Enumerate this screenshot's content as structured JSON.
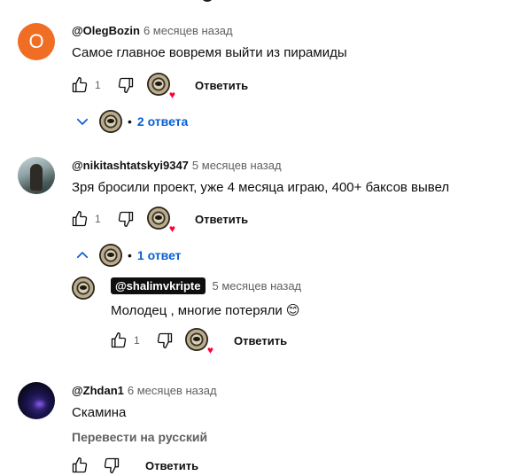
{
  "comments": [
    {
      "author": "@OlegBozin",
      "time": "6 месяцев назад",
      "avatar_letter": "O",
      "text": "Самое главное вовремя выйти из пирамиды",
      "likes": "1",
      "reply_label": "Ответить",
      "replies_label": "2 ответа"
    },
    {
      "author": "@nikitashtatskyi9347",
      "time": "5 месяцев назад",
      "text": "Зря бросили проект, уже 4 месяца играю, 400+ баксов вывел",
      "likes": "1",
      "reply_label": "Ответить",
      "replies_label": "1 ответ",
      "reply": {
        "author": "@shalimvkripte",
        "time": "5 месяцев назад",
        "text": "Молодец , многие потеряли 😊",
        "likes": "1",
        "reply_label": "Ответить"
      }
    },
    {
      "author": "@Zhdan1",
      "time": "6 месяцев назад",
      "text": "Скамина",
      "translate_label": "Перевести на русский",
      "reply_label": "Ответить"
    }
  ],
  "colors": {
    "link_blue": "#065fd4",
    "heart_red": "#ff0033",
    "letter_avatar": "#f06d24"
  },
  "icons": [
    "thumb-up-icon",
    "thumb-down-icon",
    "heart-icon",
    "chevron-down-icon",
    "chevron-up-icon"
  ]
}
